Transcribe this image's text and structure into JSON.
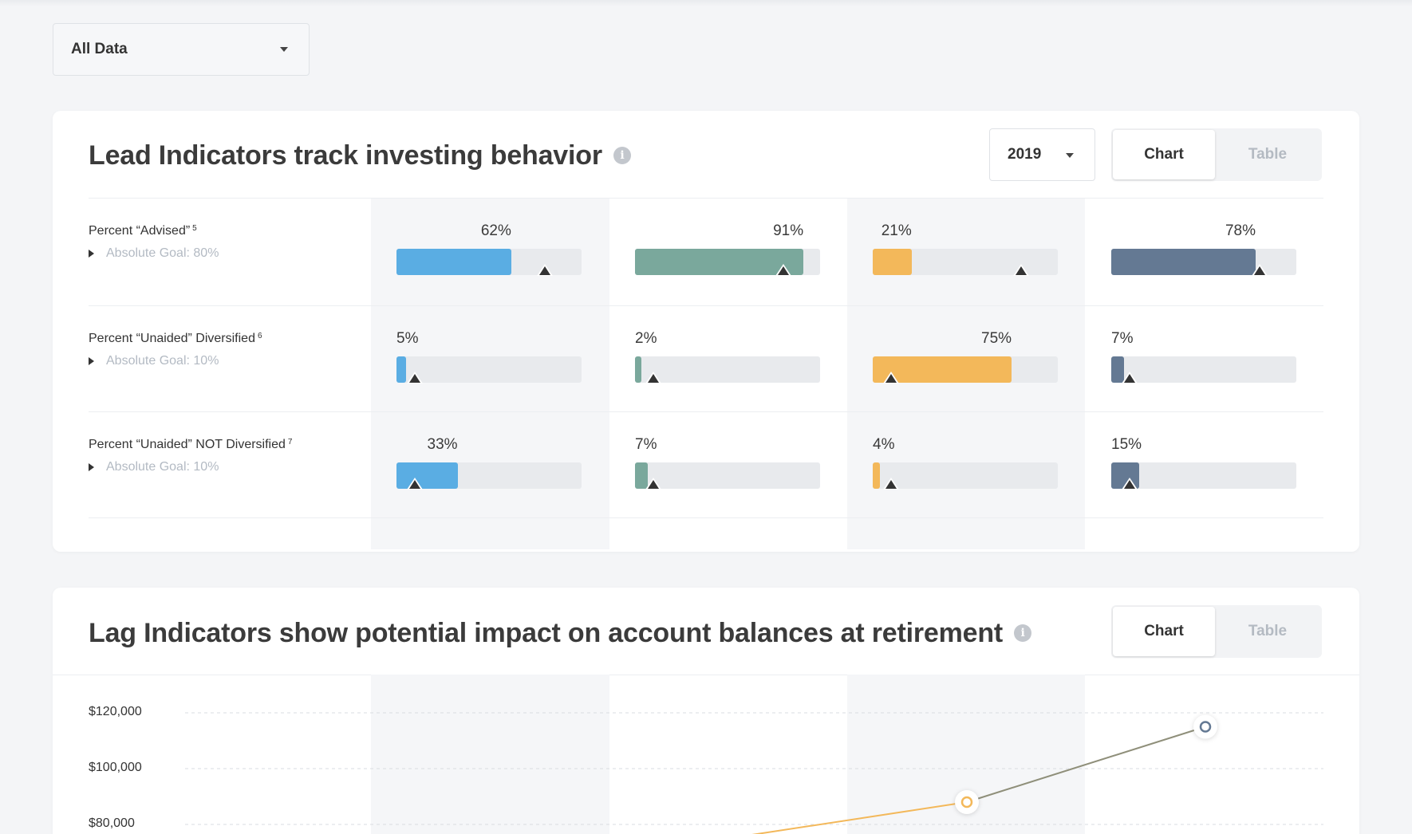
{
  "filter": {
    "label": "All Data"
  },
  "lead": {
    "title": "Lead Indicators track investing behavior",
    "info_glyph": "i",
    "year": "2019",
    "toggle": {
      "chart": "Chart",
      "table": "Table"
    },
    "colors": [
      "#5aade3",
      "#7aa89c",
      "#f3b85a",
      "#647993"
    ],
    "rows": [
      {
        "label": "Percent “Advised”",
        "sup": "5",
        "goal": "Absolute Goal: 80%",
        "goal_value": 80,
        "values": [
          62,
          91,
          21,
          78
        ],
        "labels": [
          "62%",
          "91%",
          "21%",
          "78%"
        ]
      },
      {
        "label": "Percent “Unaided” Diversified",
        "sup": "6",
        "goal": "Absolute Goal: 10%",
        "goal_value": 10,
        "values": [
          5,
          2,
          75,
          7
        ],
        "labels": [
          "5%",
          "2%",
          "75%",
          "7%"
        ]
      },
      {
        "label": "Percent “Unaided” NOT Diversified",
        "sup": "7",
        "goal": "Absolute Goal: 10%",
        "goal_value": 10,
        "values": [
          33,
          7,
          4,
          15
        ],
        "labels": [
          "33%",
          "7%",
          "4%",
          "15%"
        ]
      }
    ]
  },
  "lag": {
    "title": "Lag Indicators show potential impact on account balances at retirement",
    "info_glyph": "i",
    "toggle": {
      "chart": "Chart",
      "table": "Table"
    }
  },
  "chart_data": {
    "type": "line",
    "y_ticks": [
      "$120,000",
      "$100,000",
      "$80,000"
    ],
    "y_tick_values": [
      120000,
      100000,
      80000
    ],
    "ylim": [
      80000,
      120000
    ],
    "grid": true,
    "points": [
      {
        "column": 3,
        "value": 88000,
        "color": "#f3b85a"
      },
      {
        "column": 4,
        "value": 115000,
        "color": "#647993"
      }
    ],
    "segments": [
      {
        "from_column": 2,
        "from_value": 75000,
        "to_column": 3,
        "to_value": 88000,
        "color": "#f3b85a"
      },
      {
        "from_column": 3,
        "from_value": 88000,
        "to_column": 4,
        "to_value": 115000,
        "color": "#8f8f7a"
      }
    ]
  }
}
